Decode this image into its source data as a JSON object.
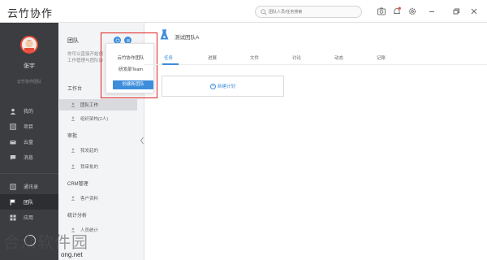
{
  "app": {
    "title": "云竹协作"
  },
  "search": {
    "placeholder": "团队人员/任务搜索"
  },
  "user": {
    "name": "张宇",
    "org": "云竹协作团队"
  },
  "sidebar": {
    "items": [
      {
        "label": "我的",
        "icon": "person-icon"
      },
      {
        "label": "项目",
        "icon": "project-icon"
      },
      {
        "label": "云盘",
        "icon": "cloud-icon"
      },
      {
        "label": "消息",
        "icon": "message-icon"
      },
      {
        "label": "通讯录",
        "icon": "contacts-icon"
      },
      {
        "label": "团队",
        "icon": "flag-icon"
      },
      {
        "label": "应用",
        "icon": "apps-icon"
      }
    ]
  },
  "panel": {
    "title": "团队",
    "hint_line1": "你可以直接开始创",
    "hint_line2": "工作管理与团队协",
    "sections": [
      {
        "label": "工作台",
        "items": [
          "团队工作",
          "组织架构(2人)"
        ]
      },
      {
        "label": "审批",
        "items": [
          "我发起的",
          "我审批的"
        ]
      },
      {
        "label": "CRM管理",
        "items": [
          "客户资料"
        ]
      },
      {
        "label": "统计分析",
        "items": [
          "人员统计"
        ]
      }
    ]
  },
  "popup": {
    "teams": [
      "云竹协作团队",
      "研发部Team"
    ],
    "create_label": "创建新团队"
  },
  "main": {
    "team_name": "测试团队A",
    "tabs": [
      "任务",
      "进展",
      "文件",
      "讨论",
      "动态",
      "记账"
    ],
    "active_tab": "任务",
    "new_plan_label": "新建计划"
  },
  "watermark": {
    "text": "合众软件园",
    "url": "ong.net"
  },
  "colors": {
    "accent": "#3c8ddb",
    "sidebar_bg": "#3b3d41",
    "highlight_box": "#e02020"
  }
}
